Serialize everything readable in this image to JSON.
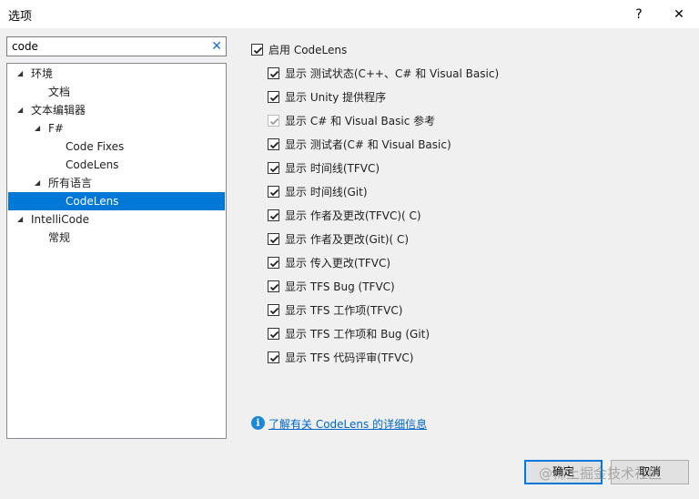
{
  "window": {
    "title": "选项",
    "help_label": "?",
    "close_label": "✕"
  },
  "search": {
    "value": "code"
  },
  "tree": {
    "nodes": [
      {
        "label": "环境",
        "expander": "◢"
      },
      {
        "label": "文档",
        "expander": ""
      },
      {
        "label": "文本编辑器",
        "expander": "◢"
      },
      {
        "label": "F#",
        "expander": "◢"
      },
      {
        "label": "Code Fixes",
        "expander": ""
      },
      {
        "label": "CodeLens",
        "expander": ""
      },
      {
        "label": "所有语言",
        "expander": "◢"
      },
      {
        "label": "CodeLens",
        "expander": "",
        "selected": true
      },
      {
        "label": "IntelliCode",
        "expander": "◢"
      },
      {
        "label": "常规",
        "expander": ""
      }
    ]
  },
  "options": {
    "enable": {
      "label": "启用 CodeLens",
      "checked": true
    },
    "items": [
      {
        "label": "显示 测试状态(C++、C# 和 Visual Basic)",
        "checked": true,
        "disabled": false
      },
      {
        "label": "显示 Unity 提供程序",
        "checked": true,
        "disabled": false
      },
      {
        "label": "显示 C# 和 Visual Basic 参考",
        "checked": true,
        "disabled": true
      },
      {
        "label": "显示 测试者(C# 和 Visual Basic)",
        "checked": true,
        "disabled": false
      },
      {
        "label": "显示 时间线(TFVC)",
        "checked": true,
        "disabled": false
      },
      {
        "label": "显示 时间线(Git)",
        "checked": true,
        "disabled": false
      },
      {
        "label": "显示 作者及更改(TFVC)( C)",
        "checked": true,
        "disabled": false
      },
      {
        "label": "显示 作者及更改(Git)( C)",
        "checked": true,
        "disabled": false
      },
      {
        "label": "显示 传入更改(TFVC)",
        "checked": true,
        "disabled": false
      },
      {
        "label": "显示 TFS Bug (TFVC)",
        "checked": true,
        "disabled": false
      },
      {
        "label": "显示 TFS 工作项(TFVC)",
        "checked": true,
        "disabled": false
      },
      {
        "label": "显示 TFS 工作项和 Bug (Git)",
        "checked": true,
        "disabled": false
      },
      {
        "label": "显示 TFS 代码评审(TFVC)",
        "checked": true,
        "disabled": false
      }
    ]
  },
  "info": {
    "icon": "info-icon",
    "link_text": "了解有关 CodeLens 的详细信息"
  },
  "buttons": {
    "ok": "确定",
    "cancel": "取消"
  },
  "watermark": "@稀土掘金技术社区",
  "colors": {
    "selection": "#0078d7",
    "link": "#0066cc",
    "info": "#1c87d6"
  }
}
